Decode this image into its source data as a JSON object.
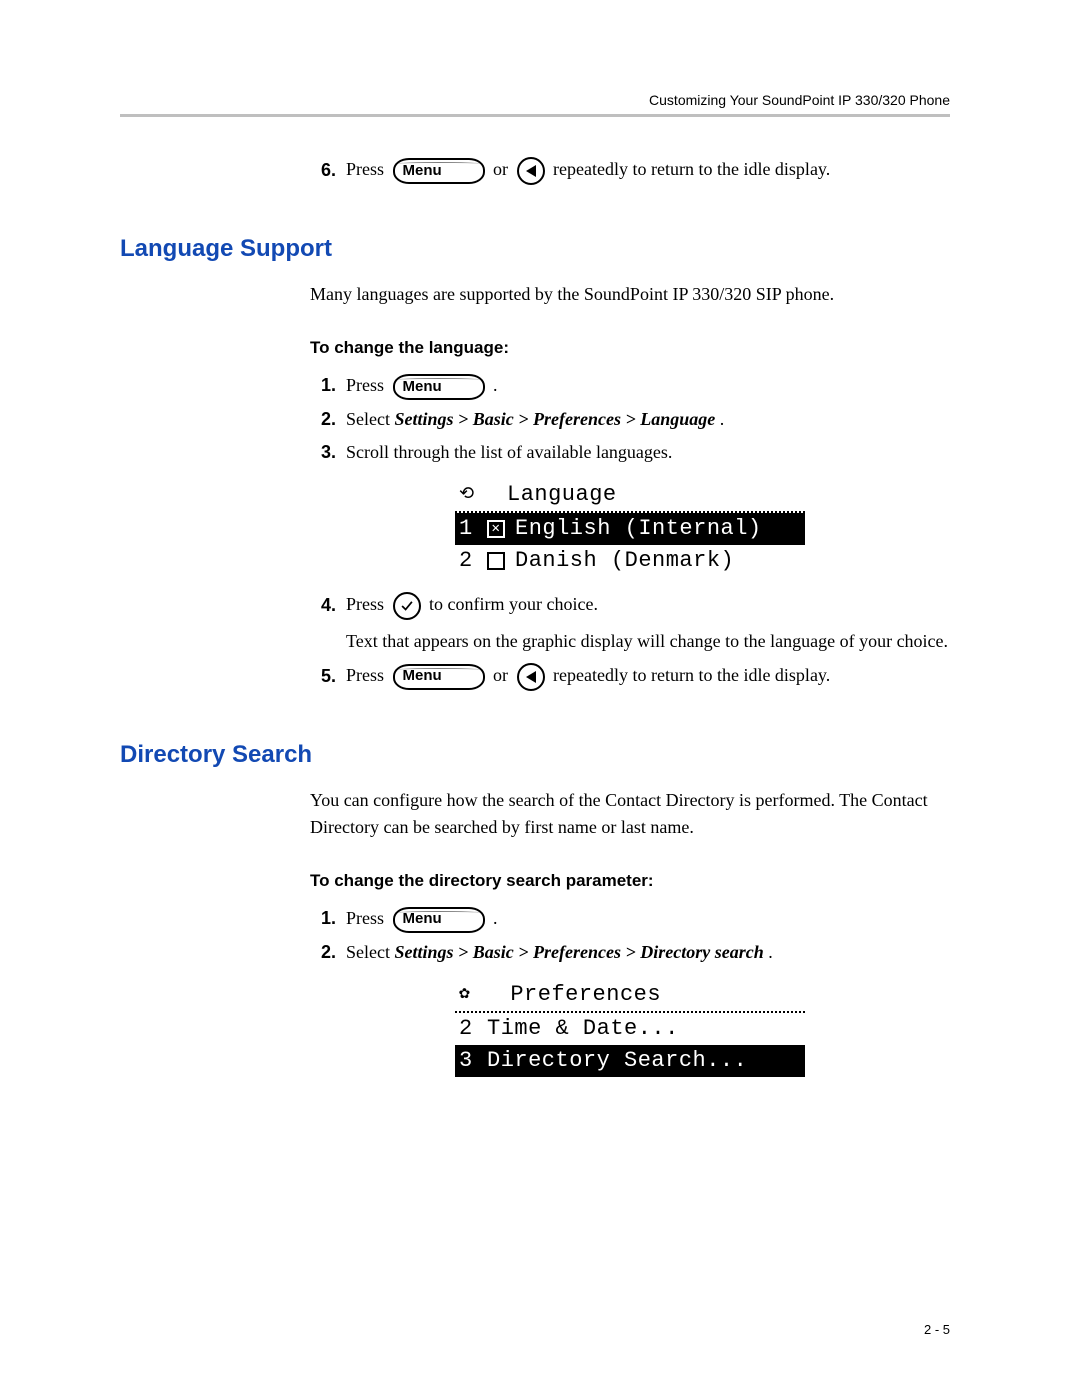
{
  "header": {
    "right": "Customizing Your SoundPoint IP 330/320 Phone"
  },
  "top_step": {
    "num": "6.",
    "press": "Press ",
    "menu_label": "Menu",
    "or": " or ",
    "after": " repeatedly to return to the idle display."
  },
  "lang": {
    "heading": "Language Support",
    "intro": "Many languages are supported by the SoundPoint IP 330/320 SIP phone.",
    "subhead": "To change the language:",
    "steps": {
      "s1": {
        "num": "1.",
        "press": "Press ",
        "menu_label": "Menu",
        "period": "."
      },
      "s2": {
        "num": "2.",
        "pre": "Select ",
        "path": "Settings > Basic > Preferences > Language",
        "post": "."
      },
      "s3": {
        "num": "3.",
        "text": "Scroll through the list of available languages."
      },
      "s4": {
        "num": "4.",
        "press": "Press ",
        "after": " to confirm your choice."
      },
      "s4_para": "Text that appears on the graphic display will change to the language of your choice.",
      "s5": {
        "num": "5.",
        "press": "Press ",
        "menu_label": "Menu",
        "or": " or ",
        "after": " repeatedly to return to the idle display."
      }
    },
    "lcd": {
      "title": "Language",
      "rows": [
        {
          "idx": "1",
          "checked": true,
          "label": "English (Internal)",
          "selected": true
        },
        {
          "idx": "2",
          "checked": false,
          "label": "Danish (Denmark)",
          "selected": false
        }
      ]
    }
  },
  "dir": {
    "heading": "Directory Search",
    "intro": "You can configure how the search of the Contact Directory is performed. The Contact Directory can be searched by first name or last name.",
    "subhead": "To change the directory search parameter:",
    "steps": {
      "s1": {
        "num": "1.",
        "press": "Press ",
        "menu_label": "Menu",
        "period": "."
      },
      "s2": {
        "num": "2.",
        "pre": "Select ",
        "path": "Settings > Basic > Preferences > Directory search",
        "post": "."
      }
    },
    "lcd": {
      "title": "Preferences",
      "rows": [
        {
          "idx": "2",
          "label": "Time & Date...",
          "selected": false
        },
        {
          "idx": "3",
          "label": "Directory Search...",
          "selected": true
        }
      ]
    }
  },
  "footer": {
    "page": "2 - 5"
  }
}
